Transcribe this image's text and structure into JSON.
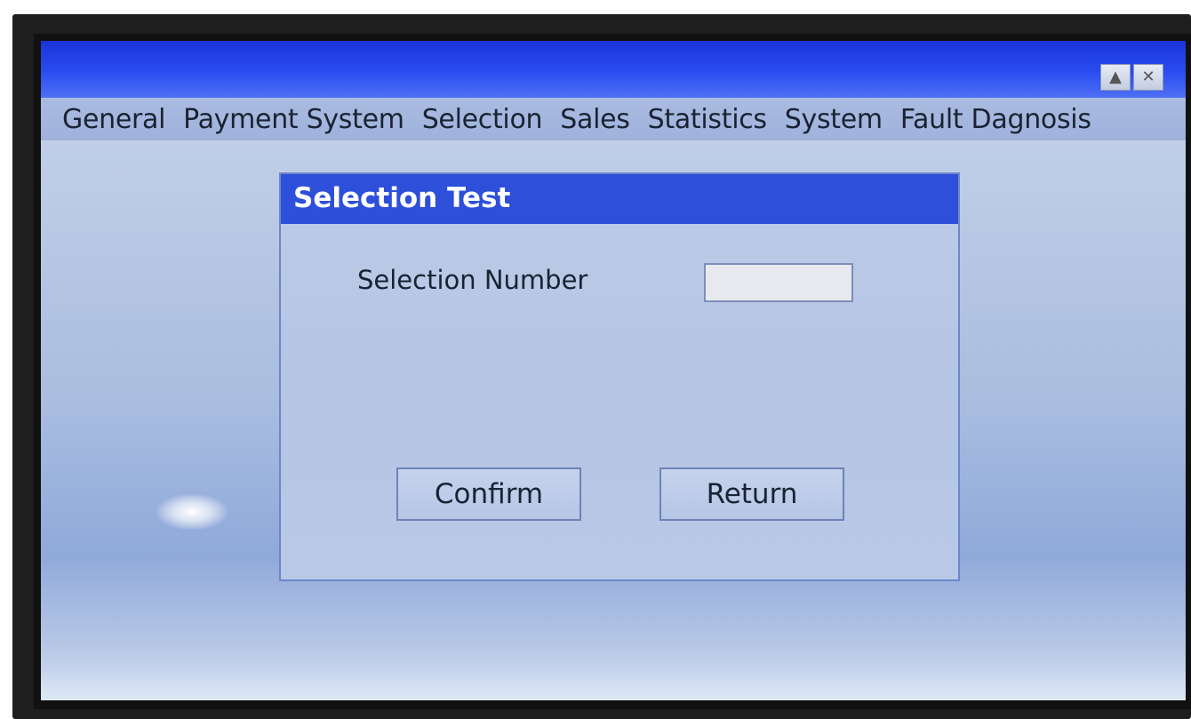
{
  "window": {
    "up_icon": "triangle-up-icon",
    "close_icon": "close-icon"
  },
  "menu": {
    "items": [
      {
        "label": "General"
      },
      {
        "label": "Payment System"
      },
      {
        "label": "Selection"
      },
      {
        "label": "Sales"
      },
      {
        "label": "Statistics"
      },
      {
        "label": "System"
      },
      {
        "label": "Fault Dagnosis"
      }
    ]
  },
  "dialog": {
    "title": "Selection Test",
    "field_label": "Selection Number",
    "field_value": "",
    "confirm_label": "Confirm",
    "return_label": "Return"
  },
  "colors": {
    "titlebar": "#2a4df0",
    "dialog_header": "#2d4fd9",
    "menubar": "#aabbe0"
  }
}
